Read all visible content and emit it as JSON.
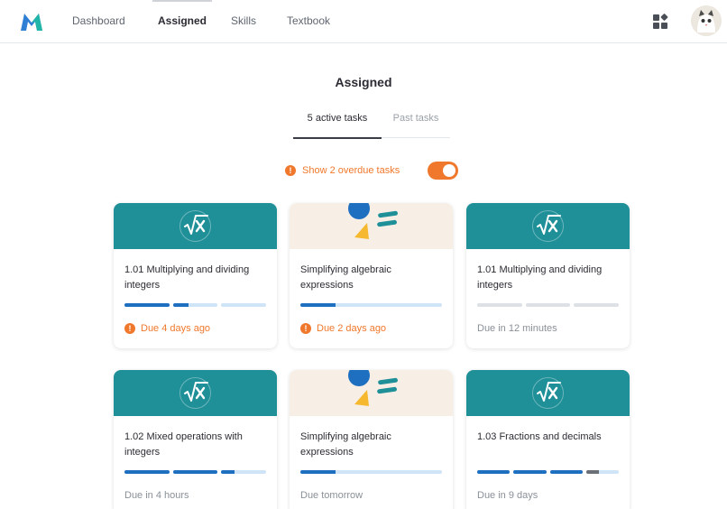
{
  "nav": {
    "items": [
      "Dashboard",
      "Assigned",
      "Skills",
      "Textbook"
    ],
    "active": "Assigned"
  },
  "page": {
    "title": "Assigned",
    "tabs": [
      "5 active tasks",
      "Past tasks"
    ]
  },
  "overdue": {
    "label": "Show 2 overdue tasks",
    "toggle_on": true
  },
  "colors": {
    "accent_teal": "#1f8f98",
    "warning_orange": "#f0782c",
    "progress_blue": "#1f6fc0"
  },
  "cards": [
    {
      "icon": "square-root-x-icon",
      "title": "1.01 Multiplying and dividing integers",
      "due": "Due 4 days ago",
      "overdue": true,
      "progress": [
        1,
        0.35,
        0
      ]
    },
    {
      "icon": "shapes-illustration",
      "title": "Simplifying algebraic expressions",
      "due": "Due 2 days ago",
      "overdue": true,
      "progress": [
        0.25
      ]
    },
    {
      "icon": "square-root-x-icon",
      "title": "1.01 Multiplying and dividing integers",
      "due": "Due in 12 minutes",
      "overdue": false,
      "progress": [
        0,
        0,
        0
      ]
    },
    {
      "icon": "square-root-x-icon",
      "title": "1.02 Mixed operations with integers",
      "due": "Due in 4 hours",
      "overdue": false,
      "progress": [
        1,
        1,
        0.3
      ]
    },
    {
      "icon": "shapes-illustration",
      "title": "Simplifying algebraic expressions",
      "due": "Due tomorrow",
      "overdue": false,
      "progress": [
        0.25
      ]
    },
    {
      "icon": "square-root-x-icon",
      "title": "1.03 Fractions and decimals",
      "due": "Due in 9 days",
      "overdue": false,
      "progress": [
        1,
        1,
        1,
        0.4
      ]
    }
  ]
}
